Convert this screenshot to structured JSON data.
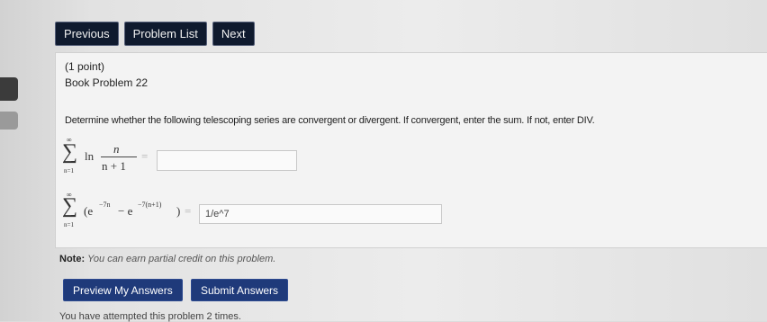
{
  "nav": {
    "previous": "Previous",
    "problem_list": "Problem List",
    "next": "Next"
  },
  "problem": {
    "points": "(1 point)",
    "title": "Book Problem 22",
    "question": "Determine whether the following telescoping series are convergent or divergent. If convergent, enter the sum. If not, enter DIV.",
    "series1": {
      "sum_upper": "∞",
      "sum_lower": "n=1",
      "fn": "ln",
      "numerator": "n",
      "denominator": "n + 1",
      "equals": "=",
      "answer": ""
    },
    "series2": {
      "sum_upper": "∞",
      "sum_lower": "n=1",
      "open": "(e",
      "exp1": "−7n",
      "minus": "− e",
      "exp2": "−7(n+1)",
      "close": ")",
      "equals": "=",
      "answer": "1/e^7"
    }
  },
  "note": {
    "label": "Note:",
    "text": "You can earn partial credit on this problem."
  },
  "actions": {
    "preview": "Preview My Answers",
    "submit": "Submit Answers"
  },
  "attempts": "You have attempted this problem 2 times."
}
